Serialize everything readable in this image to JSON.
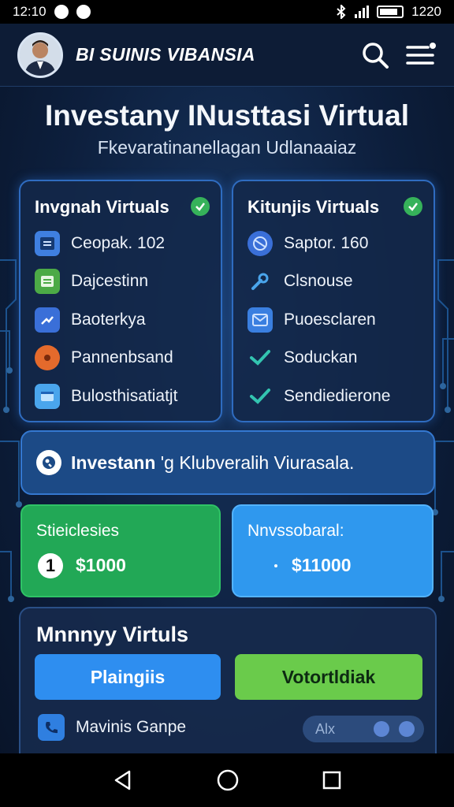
{
  "status_bar": {
    "time": "12:10",
    "battery_time": "1220"
  },
  "header": {
    "title": "BI SUINIS VIBANSIA"
  },
  "hero": {
    "title": "Investany INusttasi Virtual",
    "subtitle": "Fkevaratinanellagan Udlanaaiaz"
  },
  "left_card": {
    "title": "Invgnah Virtuals",
    "items": [
      {
        "label": "Ceopak. 102",
        "icon": "document-icon",
        "color": "#3f7fe0"
      },
      {
        "label": "Dajcestinn",
        "icon": "folder-icon",
        "color": "#4caa46"
      },
      {
        "label": "Baoterkya",
        "icon": "arrow-icon",
        "color": "#3a6fd8"
      },
      {
        "label": "Pannenbsand",
        "icon": "gear-icon",
        "color": "#e46a2c"
      },
      {
        "label": "Bulosthisatiatjt",
        "icon": "window-icon",
        "color": "#4aa5ec"
      }
    ]
  },
  "right_card": {
    "title": "Kitunjis Virtuals",
    "items": [
      {
        "label": "Saptor. 160",
        "icon": "globe-icon"
      },
      {
        "label": "Clsnouse",
        "icon": "wrench-icon"
      },
      {
        "label": "Puoesclaren",
        "icon": "mail-icon"
      },
      {
        "label": "Soduckan",
        "icon": "checkmark-icon"
      },
      {
        "label": "Sendiedierone",
        "icon": "checkmark-icon"
      }
    ]
  },
  "banner": {
    "bold": "Investann",
    "text": " 'g Klubveralih Viurasala."
  },
  "stats": {
    "left": {
      "label": "Stieiclesies",
      "badge": "1",
      "value": "$1000"
    },
    "right": {
      "label": "Nnvssobaral:",
      "value": "$11000"
    }
  },
  "bottom": {
    "title": "Mnnnyy Virtuls",
    "primary_button": "Plaingiis",
    "secondary_button": "Votortldiak",
    "row_label": "Mavinis Ganpe",
    "toggle_label": "Alx"
  },
  "colors": {
    "accent_blue": "#2e8ef0",
    "accent_green": "#2fb35c",
    "check_green": "#36b25a",
    "secondary_green": "#6acb4b"
  }
}
